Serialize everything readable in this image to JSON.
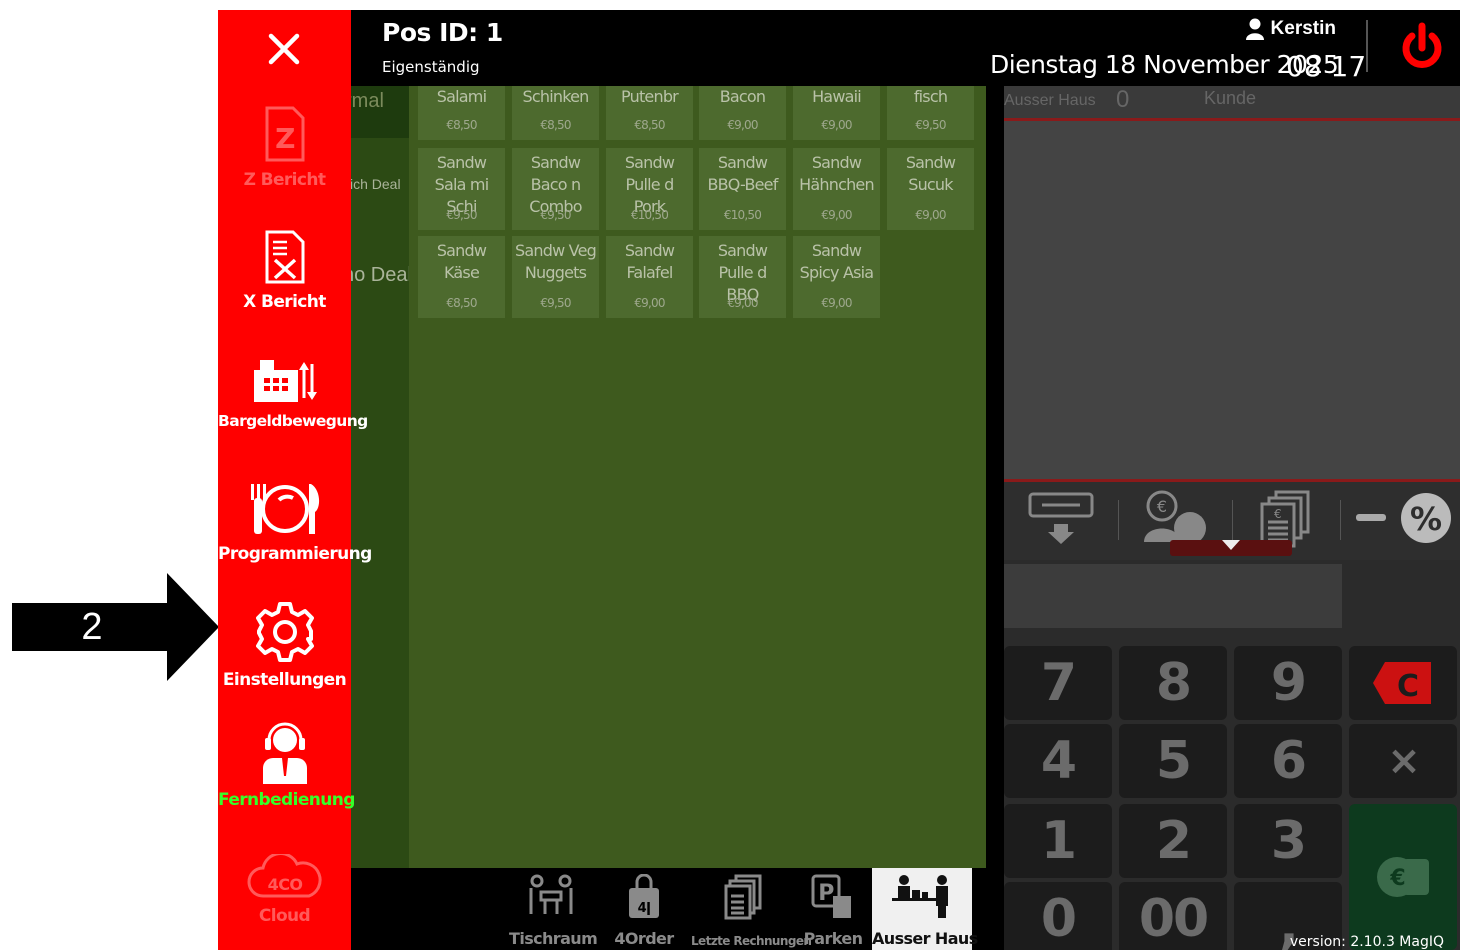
{
  "annotation": {
    "label": "2"
  },
  "header": {
    "pos_id": "Pos ID: 1",
    "mode": "Eigenständig",
    "user": "Kerstin",
    "date": "Dienstag 18 November 2025",
    "time": "08 17"
  },
  "menu": {
    "items": [
      {
        "label": "Z Bericht",
        "icon": "z-report-icon",
        "disabled": true
      },
      {
        "label": "X Bericht",
        "icon": "x-report-icon"
      },
      {
        "label": "Bargeldbewegung",
        "icon": "cash-register-icon"
      },
      {
        "label": "Programmierung",
        "icon": "plate-cutlery-icon"
      },
      {
        "label": "Einstellungen",
        "icon": "gear-icon"
      },
      {
        "label": "Fernbedienung",
        "icon": "support-agent-icon"
      },
      {
        "label": "Cloud",
        "icon": "cloud-icon",
        "disabled": true
      }
    ]
  },
  "categories": [
    "rmal",
    "vich Deal",
    "no Deal"
  ],
  "products": [
    {
      "name": "Salami",
      "price": "€8,50"
    },
    {
      "name": "Schinken",
      "price": "€8,50"
    },
    {
      "name": "Putenbr",
      "price": "€8,50"
    },
    {
      "name": "Bacon",
      "price": "€9,00"
    },
    {
      "name": "Hawaii",
      "price": "€9,00"
    },
    {
      "name": "fisch",
      "price": "€9,50"
    },
    {
      "name": "Sandw Sala mi Schi",
      "price": "€9,50"
    },
    {
      "name": "Sandw Baco n Combo",
      "price": "€9,50"
    },
    {
      "name": "Sandw Pulle d Pork",
      "price": "€10,50"
    },
    {
      "name": "Sandw BBQ-Beef",
      "price": "€10,50"
    },
    {
      "name": "Sandw Hähnchen",
      "price": "€9,00"
    },
    {
      "name": "Sandw Sucuk",
      "price": "€9,00"
    },
    {
      "name": "Sandw Käse",
      "price": "€8,50"
    },
    {
      "name": "Sandw Veg Nuggets",
      "price": "€9,50"
    },
    {
      "name": "Sandw Falafel",
      "price": "€9,00"
    },
    {
      "name": "Sandw Pulle d BBQ",
      "price": "€9,00"
    },
    {
      "name": "Sandw Spicy Asia",
      "price": "€9,00"
    }
  ],
  "bottom_nav": [
    {
      "label": "Tischraum",
      "icon": "table-chairs-icon"
    },
    {
      "label": "4Order",
      "icon": "shopping-bag-icon"
    },
    {
      "label": "Letzte Rechnungen",
      "icon": "receipts-icon"
    },
    {
      "label": "Parken",
      "icon": "parking-icon"
    },
    {
      "label": "Ausser Haus",
      "icon": "takeaway-icon",
      "active": true
    }
  ],
  "order_panel": {
    "mode": "Ausser Haus",
    "count": "0",
    "customer": "Kunde"
  },
  "keypad": [
    "7",
    "8",
    "9",
    "C",
    "4",
    "5",
    "6",
    "×",
    "1",
    "2",
    "3",
    "0",
    "00",
    ","
  ],
  "version": "version: 2.10.3 MagIQ"
}
